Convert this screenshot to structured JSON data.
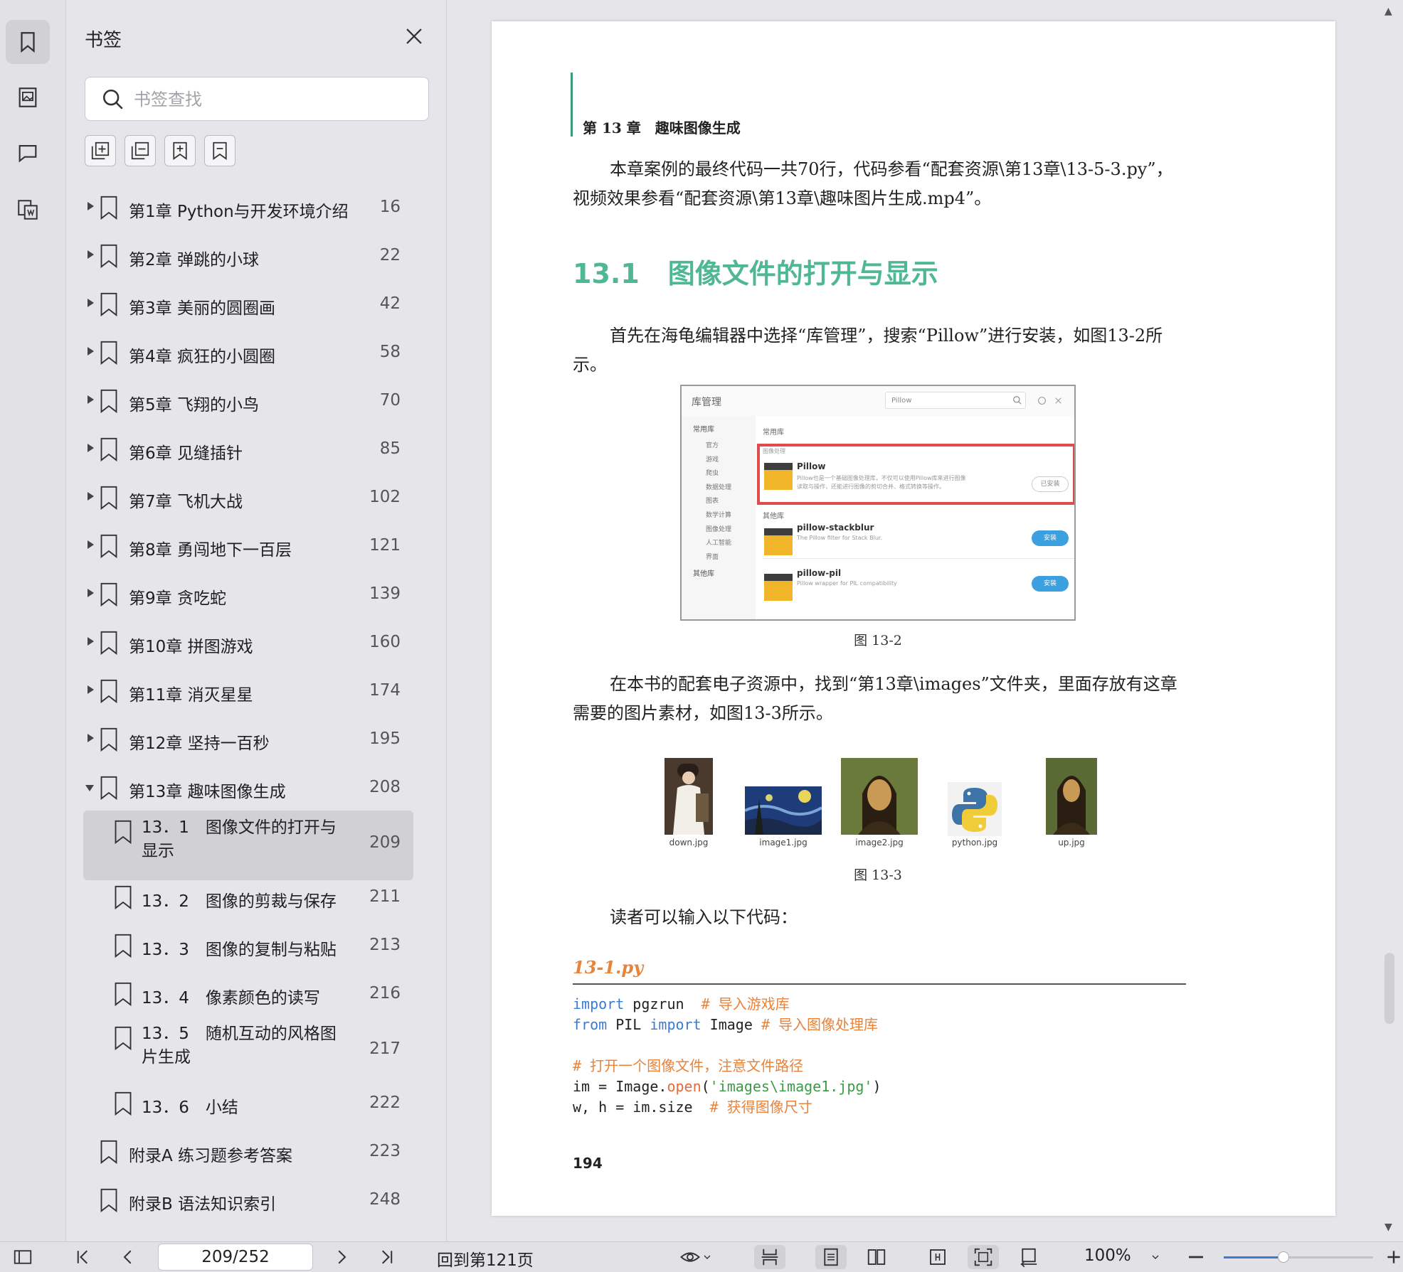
{
  "panel": {
    "title": "书签",
    "search_placeholder": "书签查找"
  },
  "bookmarks": [
    {
      "label": "第1章 Python与开发环境介绍",
      "page": "16",
      "level": 0,
      "expanded": false
    },
    {
      "label": "第2章 弹跳的小球",
      "page": "22",
      "level": 0,
      "expanded": false
    },
    {
      "label": "第3章 美丽的圆圈画",
      "page": "42",
      "level": 0,
      "expanded": false
    },
    {
      "label": "第4章 疯狂的小圆圈",
      "page": "58",
      "level": 0,
      "expanded": false
    },
    {
      "label": "第5章 飞翔的小鸟",
      "page": "70",
      "level": 0,
      "expanded": false
    },
    {
      "label": "第6章 见缝插针",
      "page": "85",
      "level": 0,
      "expanded": false
    },
    {
      "label": "第7章 飞机大战",
      "page": "102",
      "level": 0,
      "expanded": false
    },
    {
      "label": "第8章 勇闯地下一百层",
      "page": "121",
      "level": 0,
      "expanded": false
    },
    {
      "label": "第9章 贪吃蛇",
      "page": "139",
      "level": 0,
      "expanded": false
    },
    {
      "label": "第10章 拼图游戏",
      "page": "160",
      "level": 0,
      "expanded": false
    },
    {
      "label": "第11章 消灭星星",
      "page": "174",
      "level": 0,
      "expanded": false
    },
    {
      "label": "第12章 坚持一百秒",
      "page": "195",
      "level": 0,
      "expanded": false
    },
    {
      "label": "第13章 趣味图像生成",
      "page": "208",
      "level": 0,
      "expanded": true
    },
    {
      "label": "13．1　图像文件的打开与显示",
      "page": "209",
      "level": 1,
      "selected": true
    },
    {
      "label": "13．2　图像的剪裁与保存",
      "page": "211",
      "level": 1
    },
    {
      "label": "13．3　图像的复制与粘贴",
      "page": "213",
      "level": 1
    },
    {
      "label": "13．4　像素颜色的读写",
      "page": "216",
      "level": 1
    },
    {
      "label": "13．5　随机互动的风格图片生成",
      "page": "217",
      "level": 1
    },
    {
      "label": "13．6　小结",
      "page": "222",
      "level": 1
    },
    {
      "label": "附录A 练习题参考答案",
      "page": "223",
      "level": 0,
      "leaf": true
    },
    {
      "label": "附录B 语法知识索引",
      "page": "248",
      "level": 0,
      "leaf": true
    }
  ],
  "doc": {
    "chapter_header": "第 13 章　趣味图像生成",
    "intro": "本章案例的最终代码一共70行，代码参看“配套资源\\第13章\\13-5-3.py”，视频效果参看“配套资源\\第13章\\趣味图片生成.mp4”。",
    "section_num": "13.1",
    "section_title": "图像文件的打开与显示",
    "para1": "首先在海龟编辑器中选择“库管理”，搜索“Pillow”进行安装，如图13-2所示。",
    "fig2": {
      "window_title": "库管理",
      "search_text": "Pillow",
      "sidebar_top": "常用库",
      "sidebar": [
        "官方",
        "游戏",
        "爬虫",
        "数据处理",
        "图表",
        "数学计算",
        "图像处理",
        "人工智能",
        "界面"
      ],
      "sidebar_bottom": "其他库",
      "group_common": "常用库",
      "group_image": "图像处理",
      "group_other": "其他库",
      "packages": [
        {
          "name": "Pillow",
          "desc": "Pillow也是一个基础图像处理库，不仅可以使用Pillow库来进行图像读取与操作，还能进行图像的剪切合并、格式转换等操作。",
          "button": "已安装"
        },
        {
          "name": "pillow-stackblur",
          "desc": "The Pillow filter for Stack Blur.",
          "button": "安装"
        },
        {
          "name": "pillow-pil",
          "desc": "Pillow wrapper for PIL compatibility",
          "button": "安装"
        }
      ]
    },
    "fig2_caption": "图 13-2",
    "para2": "在本书的配套电子资源中，找到“第13章\\images”文件夹，里面存放有这章需要的图片素材，如图13-3所示。",
    "thumbnails": [
      "down.jpg",
      "image1.jpg",
      "image2.jpg",
      "python.jpg",
      "up.jpg"
    ],
    "fig3_caption": "图 13-3",
    "para3": "读者可以输入以下代码：",
    "code_title": "13-1.py",
    "code": {
      "l1_kw": "import",
      "l1_rest": " pgzrun  ",
      "l1_cm": "# 导入游戏库",
      "l2_kw1": "from",
      "l2_mid": " PIL ",
      "l2_kw2": "import",
      "l2_rest": " Image ",
      "l2_cm": "# 导入图像处理库",
      "l4_cm": "# 打开一个图像文件，注意文件路径",
      "l5_a": "im = Image.",
      "l5_fn": "open",
      "l5_b": "(",
      "l5_st": "'images\\image1.jpg'",
      "l5_c": ")",
      "l6_a": "w, h = im.size  ",
      "l6_cm": "# 获得图像尺寸"
    },
    "page_number": "194"
  },
  "bottombar": {
    "page_field": "209/252",
    "goto_text": "回到第121页",
    "zoom": "100%",
    "zoom_level": 0.4
  }
}
